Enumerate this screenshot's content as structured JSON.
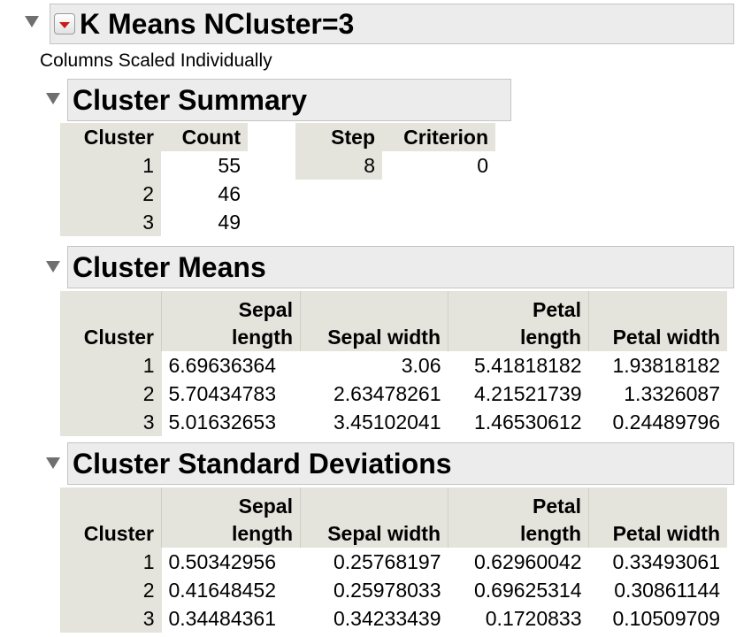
{
  "report": {
    "title": "K Means NCluster=3",
    "note": "Columns Scaled Individually"
  },
  "summary": {
    "title": "Cluster Summary",
    "count_table": {
      "headers": [
        "Cluster",
        "Count"
      ],
      "rows": [
        [
          "1",
          "55"
        ],
        [
          "2",
          "46"
        ],
        [
          "3",
          "49"
        ]
      ]
    },
    "step_table": {
      "headers": [
        "Step",
        "Criterion"
      ],
      "rows": [
        [
          "8",
          "0"
        ]
      ]
    }
  },
  "means": {
    "title": "Cluster Means",
    "headers": {
      "cluster": "Cluster",
      "sepal_length": [
        "Sepal",
        "length"
      ],
      "sepal_width": "Sepal width",
      "petal_length": [
        "Petal",
        "length"
      ],
      "petal_width": "Petal width"
    },
    "rows": [
      [
        "1",
        "6.69636364",
        "3.06",
        "5.41818182",
        "1.93818182"
      ],
      [
        "2",
        "5.70434783",
        "2.63478261",
        "4.21521739",
        "1.3326087"
      ],
      [
        "3",
        "5.01632653",
        "3.45102041",
        "1.46530612",
        "0.24489796"
      ]
    ]
  },
  "stddev": {
    "title": "Cluster Standard Deviations",
    "headers": {
      "cluster": "Cluster",
      "sepal_length": [
        "Sepal",
        "length"
      ],
      "sepal_width": "Sepal width",
      "petal_length": [
        "Petal",
        "length"
      ],
      "petal_width": "Petal width"
    },
    "rows": [
      [
        "1",
        "0.50342956",
        "0.25768197",
        "0.62960042",
        "0.33493061"
      ],
      [
        "2",
        "0.41648452",
        "0.25978033",
        "0.69625314",
        "0.30861144"
      ],
      [
        "3",
        "0.34484361",
        "0.34233439",
        "0.1720833",
        "0.10509709"
      ]
    ]
  },
  "icons": {
    "disclosure": "disclosure-triangle-icon",
    "menu": "red-dropdown-menu-icon"
  }
}
